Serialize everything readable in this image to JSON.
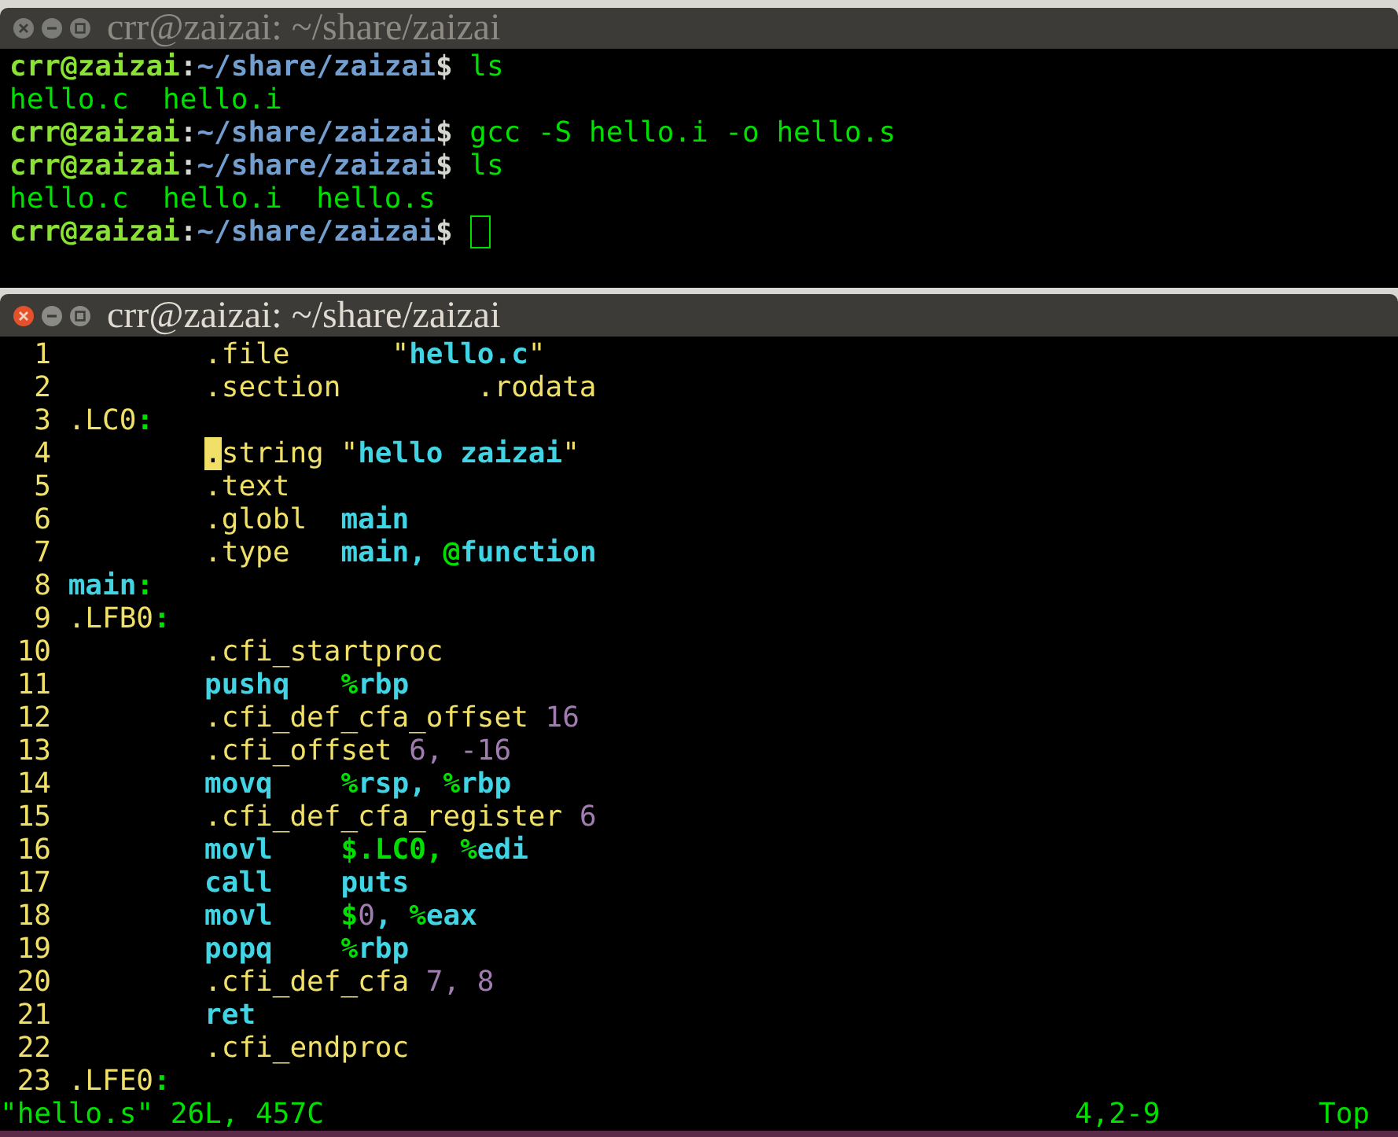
{
  "terminal": {
    "title": "crr@zaizai: ~/share/zaizai",
    "active": false,
    "cursor": true,
    "lines": [
      {
        "segments": [
          {
            "kind": "user",
            "text": "crr@zaizai"
          },
          {
            "kind": "sep",
            "text": ":"
          },
          {
            "kind": "path",
            "text": "~/share/zaizai"
          },
          {
            "kind": "sep",
            "text": "$ "
          },
          {
            "kind": "out",
            "text": "ls"
          }
        ]
      },
      {
        "segments": [
          {
            "kind": "out",
            "text": "hello.c  hello.i"
          }
        ]
      },
      {
        "segments": [
          {
            "kind": "user",
            "text": "crr@zaizai"
          },
          {
            "kind": "sep",
            "text": ":"
          },
          {
            "kind": "path",
            "text": "~/share/zaizai"
          },
          {
            "kind": "sep",
            "text": "$ "
          },
          {
            "kind": "out",
            "text": "gcc -S hello.i -o hello.s"
          }
        ]
      },
      {
        "segments": [
          {
            "kind": "user",
            "text": "crr@zaizai"
          },
          {
            "kind": "sep",
            "text": ":"
          },
          {
            "kind": "path",
            "text": "~/share/zaizai"
          },
          {
            "kind": "sep",
            "text": "$ "
          },
          {
            "kind": "out",
            "text": "ls"
          }
        ]
      },
      {
        "segments": [
          {
            "kind": "out",
            "text": "hello.c  hello.i  hello.s"
          }
        ]
      },
      {
        "segments": [
          {
            "kind": "user",
            "text": "crr@zaizai"
          },
          {
            "kind": "sep",
            "text": ":"
          },
          {
            "kind": "path",
            "text": "~/share/zaizai"
          },
          {
            "kind": "sep",
            "text": "$ "
          }
        ]
      }
    ]
  },
  "editor": {
    "title": "crr@zaizai: ~/share/zaizai",
    "active": true,
    "lines": [
      {
        "number": "1",
        "indented": true,
        "segments": [
          {
            "kind": "dir",
            "text": ".file      \""
          },
          {
            "kind": "kw",
            "text": "hello.c"
          },
          {
            "kind": "dir",
            "text": "\""
          }
        ]
      },
      {
        "number": "2",
        "indented": true,
        "segments": [
          {
            "kind": "dir",
            "text": ".section        .rodata"
          }
        ]
      },
      {
        "number": "3",
        "indented": false,
        "segments": [
          {
            "kind": "dir",
            "text": ".LC0"
          },
          {
            "kind": "sym",
            "text": ":"
          }
        ]
      },
      {
        "number": "4",
        "indented": true,
        "segments": [
          {
            "kind": "cursor",
            "text": "."
          },
          {
            "kind": "dir",
            "text": "string \""
          },
          {
            "kind": "kw",
            "text": "hello zaizai"
          },
          {
            "kind": "dir",
            "text": "\""
          }
        ]
      },
      {
        "number": "5",
        "indented": true,
        "segments": [
          {
            "kind": "dir",
            "text": ".text"
          }
        ]
      },
      {
        "number": "6",
        "indented": true,
        "segments": [
          {
            "kind": "dir",
            "text": ".globl  "
          },
          {
            "kind": "kw",
            "text": "main"
          }
        ]
      },
      {
        "number": "7",
        "indented": true,
        "segments": [
          {
            "kind": "dir",
            "text": ".type   "
          },
          {
            "kind": "kw",
            "text": "main, "
          },
          {
            "kind": "sym",
            "text": "@"
          },
          {
            "kind": "kw",
            "text": "function"
          }
        ]
      },
      {
        "number": "8",
        "indented": false,
        "segments": [
          {
            "kind": "kw",
            "text": "main"
          },
          {
            "kind": "sym",
            "text": ":"
          }
        ]
      },
      {
        "number": "9",
        "indented": false,
        "segments": [
          {
            "kind": "dir",
            "text": ".LFB0"
          },
          {
            "kind": "sym",
            "text": ":"
          }
        ]
      },
      {
        "number": "10",
        "indented": true,
        "segments": [
          {
            "kind": "dir",
            "text": ".cfi_startproc"
          }
        ]
      },
      {
        "number": "11",
        "indented": true,
        "segments": [
          {
            "kind": "kw",
            "text": "pushq   "
          },
          {
            "kind": "sym",
            "text": "%"
          },
          {
            "kind": "kw",
            "text": "rbp"
          }
        ]
      },
      {
        "number": "12",
        "indented": true,
        "segments": [
          {
            "kind": "dir",
            "text": ".cfi_def_cfa_offset "
          },
          {
            "kind": "num",
            "text": "16"
          }
        ]
      },
      {
        "number": "13",
        "indented": true,
        "segments": [
          {
            "kind": "dir",
            "text": ".cfi_offset "
          },
          {
            "kind": "num",
            "text": "6, -16"
          }
        ]
      },
      {
        "number": "14",
        "indented": true,
        "segments": [
          {
            "kind": "kw",
            "text": "movq    "
          },
          {
            "kind": "sym",
            "text": "%"
          },
          {
            "kind": "kw",
            "text": "rsp, "
          },
          {
            "kind": "sym",
            "text": "%"
          },
          {
            "kind": "kw",
            "text": "rbp"
          }
        ]
      },
      {
        "number": "15",
        "indented": true,
        "segments": [
          {
            "kind": "dir",
            "text": ".cfi_def_cfa_register "
          },
          {
            "kind": "num",
            "text": "6"
          }
        ]
      },
      {
        "number": "16",
        "indented": true,
        "segments": [
          {
            "kind": "kw",
            "text": "movl    "
          },
          {
            "kind": "sym",
            "text": "$.LC0, %"
          },
          {
            "kind": "kw",
            "text": "edi"
          }
        ]
      },
      {
        "number": "17",
        "indented": true,
        "segments": [
          {
            "kind": "kw",
            "text": "call    puts"
          }
        ]
      },
      {
        "number": "18",
        "indented": true,
        "segments": [
          {
            "kind": "kw",
            "text": "movl    "
          },
          {
            "kind": "sym",
            "text": "$"
          },
          {
            "kind": "num",
            "text": "0"
          },
          {
            "kind": "kw",
            "text": ", "
          },
          {
            "kind": "sym",
            "text": "%"
          },
          {
            "kind": "kw",
            "text": "eax"
          }
        ]
      },
      {
        "number": "19",
        "indented": true,
        "segments": [
          {
            "kind": "kw",
            "text": "popq    "
          },
          {
            "kind": "sym",
            "text": "%"
          },
          {
            "kind": "kw",
            "text": "rbp"
          }
        ]
      },
      {
        "number": "20",
        "indented": true,
        "segments": [
          {
            "kind": "dir",
            "text": ".cfi_def_cfa "
          },
          {
            "kind": "num",
            "text": "7, 8"
          }
        ]
      },
      {
        "number": "21",
        "indented": true,
        "segments": [
          {
            "kind": "kw",
            "text": "ret"
          }
        ]
      },
      {
        "number": "22",
        "indented": true,
        "segments": [
          {
            "kind": "dir",
            "text": ".cfi_endproc"
          }
        ]
      },
      {
        "number": "23",
        "indented": false,
        "segments": [
          {
            "kind": "dir",
            "text": ".LFE0"
          },
          {
            "kind": "sym",
            "text": ":"
          }
        ]
      }
    ],
    "status": {
      "message": "\"hello.s\" 26L, 457C",
      "position": "4,2-9",
      "scroll": "Top"
    }
  }
}
